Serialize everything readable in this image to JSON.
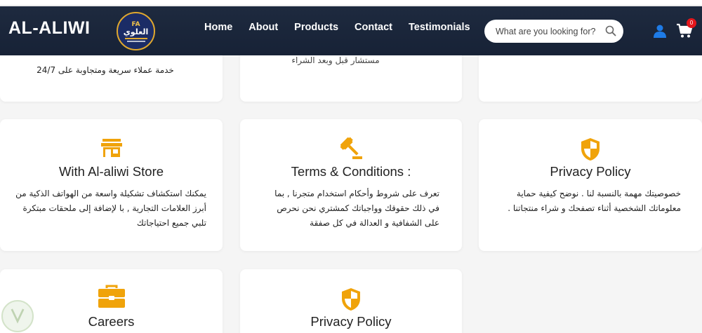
{
  "header": {
    "brand": "AL-ALIWI",
    "logo": {
      "line1": "FA",
      "line2": "العلوي"
    },
    "nav": [
      "Home",
      "About",
      "Products",
      "Contact",
      "Testimonials"
    ],
    "search_placeholder": "What are you looking for?",
    "cart_count": "0"
  },
  "top_row": {
    "left_text": "خدمة عملاء سريعة ومتجاوبة على 24/7",
    "middle_text": "مستشار قبل وبعد الشراء"
  },
  "cards": [
    {
      "title": "With Al-aliwi Store",
      "icon": "store-icon",
      "text": "يمكنك استكشاف تشكيلة واسعة من الهواتف الذكية من أبرز العلامات التجارية , با لإضافة إلى ملحقات مبتكرة تلبي جميع احتياجاتك"
    },
    {
      "title": "Terms & Conditions :",
      "icon": "gavel-icon",
      "text": "تعرف على شروط وأحكام استخدام متجرنا , بما في ذلك حقوقك وواجباتك كمشتري نحن نحرص على الشفافية و العدالة في كل صفقة"
    },
    {
      "title": "Privacy Policy",
      "icon": "shield-icon",
      "text": "خصوصيتك مهمة بالنسبة لنا . نوضح كيفية حماية معلوماتك الشخصية أثناء تصفحك و شراء منتجاتنا ."
    },
    {
      "title": "Careers",
      "icon": "briefcase-icon"
    },
    {
      "title": "Privacy Policy",
      "icon": "shield-icon"
    }
  ],
  "colors": {
    "header_bg": "#1b2438",
    "accent": "#f0a30a",
    "user_icon": "#1e7be6",
    "badge": "#e4161b"
  }
}
